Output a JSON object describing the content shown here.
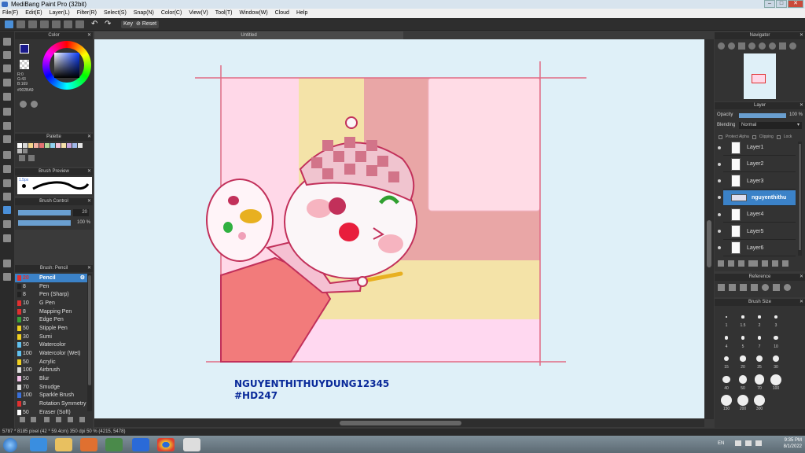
{
  "window": {
    "title": "MediBang Paint Pro (32bit)"
  },
  "menu": [
    "File(F)",
    "Edit(E)",
    "Layer(L)",
    "Filter(R)",
    "Select(S)",
    "Snap(N)",
    "Color(C)",
    "View(V)",
    "Tool(T)",
    "Window(W)",
    "Cloud",
    "Help"
  ],
  "toolbar": {
    "key_label": "Key",
    "reset_label": "Reset"
  },
  "document": {
    "tab_title": "Untitled"
  },
  "color_panel": {
    "title": "Color",
    "r": "R:0",
    "g": "G:43",
    "b": "B:169",
    "hex": "#002BA9",
    "primary": "#1a1a8c",
    "secondary": "#e03030"
  },
  "palette_panel": {
    "title": "Palette",
    "colors": [
      "#ffffff",
      "#d9d9d9",
      "#f4d58c",
      "#f2b0a0",
      "#e37272",
      "#b4d89a",
      "#8fd0ee",
      "#f4c2d8",
      "#f5e0a8",
      "#c7a3dd",
      "#9fb8e8",
      "#e5e5e5",
      "#bbbbbb",
      "#888888"
    ]
  },
  "brush_preview": {
    "title": "Brush Preview",
    "size_label": "1.5px"
  },
  "brush_control": {
    "title": "Brush Control",
    "size": "20",
    "opacity": "100 %"
  },
  "brush_panel": {
    "title": "Brush: Pencil",
    "brushes": [
      {
        "size": "20",
        "name": "Pencil",
        "color": "#e03030",
        "selected": true
      },
      {
        "size": "8",
        "name": "Pen",
        "color": "#222222"
      },
      {
        "size": "8",
        "name": "Pen (Sharp)",
        "color": "#222222"
      },
      {
        "size": "10",
        "name": "G Pen",
        "color": "#e03030"
      },
      {
        "size": "8",
        "name": "Mapping Pen",
        "color": "#e03030"
      },
      {
        "size": "20",
        "name": "Edge Pen",
        "color": "#3aa03a"
      },
      {
        "size": "50",
        "name": "Stipple Pen",
        "color": "#f0d020"
      },
      {
        "size": "30",
        "name": "Sumi",
        "color": "#f0d020"
      },
      {
        "size": "50",
        "name": "Watercolor",
        "color": "#60c0ee"
      },
      {
        "size": "100",
        "name": "Watercolor (Wet)",
        "color": "#60c0ee"
      },
      {
        "size": "50",
        "name": "Acrylic",
        "color": "#f0d020"
      },
      {
        "size": "100",
        "name": "Airbrush",
        "color": "#dddddd"
      },
      {
        "size": "50",
        "name": "Blur",
        "color": "#f4c2e8"
      },
      {
        "size": "70",
        "name": "Smudge",
        "color": "#dddddd"
      },
      {
        "size": "100",
        "name": "Sparkle Brush",
        "color": "#3a6fd8"
      },
      {
        "size": "8",
        "name": "Rotation Symmetry",
        "color": "#e03030"
      },
      {
        "size": "50",
        "name": "Eraser (Soft)",
        "color": "#ffffff"
      }
    ]
  },
  "navigator": {
    "title": "Navigator"
  },
  "layer_panel": {
    "title": "Layer",
    "opacity_label": "Opacity",
    "opacity_value": "100 %",
    "opacity_fraction": 1.0,
    "blending_label": "Blending",
    "blending_value": "Normal",
    "protect_alpha": "Protect Alpha",
    "clipping": "Clipping",
    "lock": "Lock",
    "layers": [
      "Layer1",
      "Layer2",
      "Layer3",
      "nguyenthithu",
      "Layer4",
      "Layer5",
      "Layer6"
    ],
    "selected_index": 3
  },
  "reference": {
    "title": "Reference"
  },
  "brush_size": {
    "title": "Brush Size",
    "sizes": [
      "1",
      "1.5",
      "2",
      "3",
      "4",
      "5",
      "7",
      "10",
      "15",
      "20",
      "25",
      "30",
      "40",
      "50",
      "70",
      "100",
      "150",
      "200",
      "300"
    ]
  },
  "artwork": {
    "line1": "NGUYENTHITHUYDUNG12345",
    "line2": "#HD247"
  },
  "status": {
    "text": "5787 * 8185 pixel (42 * 59.4cm) 350 dpi 50 % (4215, 5478)"
  },
  "taskbar": {
    "lang": "EN",
    "time": "9:35 PM",
    "date": "8/1/2022"
  }
}
